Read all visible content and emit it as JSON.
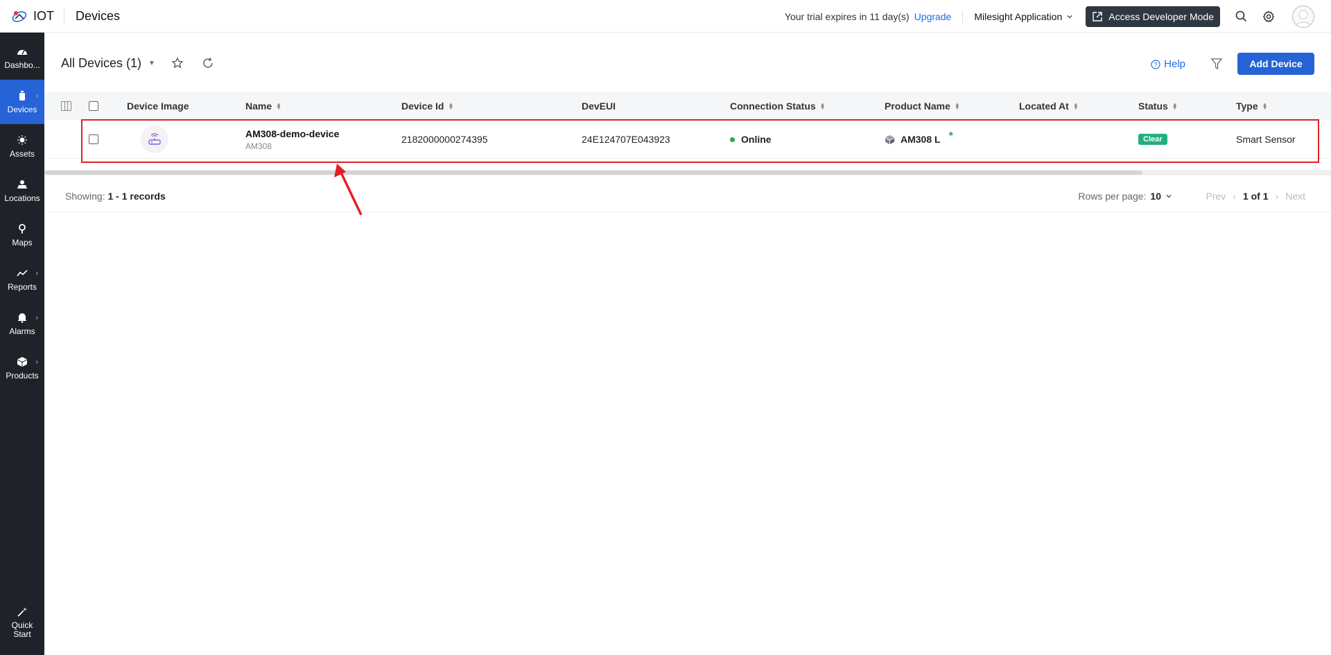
{
  "header": {
    "logo_text": "IOT",
    "page_title": "Devices",
    "trial_text": "Your trial expires in 11 day(s)",
    "upgrade_label": "Upgrade",
    "app_name": "Milesight Application",
    "dev_mode_label": "Access Developer Mode"
  },
  "sidebar": {
    "items": [
      {
        "label": "Dashbo..."
      },
      {
        "label": "Devices"
      },
      {
        "label": "Assets"
      },
      {
        "label": "Locations"
      },
      {
        "label": "Maps"
      },
      {
        "label": "Reports"
      },
      {
        "label": "Alarms"
      },
      {
        "label": "Products"
      }
    ],
    "quick_start": [
      "Quick",
      "Start"
    ]
  },
  "toolbar": {
    "view_title": "All Devices (1)",
    "help_label": "Help",
    "add_label": "Add Device"
  },
  "table": {
    "columns": [
      "Device Image",
      "Name",
      "Device Id",
      "DevEUI",
      "Connection Status",
      "Product Name",
      "Located At",
      "Status",
      "Type"
    ],
    "rows": [
      {
        "name": "AM308-demo-device",
        "model": "AM308",
        "device_id": "2182000000274395",
        "deveui": "24E124707E043923",
        "connection": "Online",
        "product": "AM308 L",
        "product_mark": "*",
        "located_at": "",
        "status": "Clear",
        "type": "Smart Sensor"
      }
    ]
  },
  "footer": {
    "showing_label": "Showing:",
    "showing_value": "1 - 1 records",
    "rpp_label": "Rows per page:",
    "rpp_value": "10",
    "prev_label": "Prev",
    "page_info": "1 of 1",
    "next_label": "Next"
  },
  "colors": {
    "accent": "#2563d6",
    "sidebar_bg": "#1f2329",
    "online": "#22a85a",
    "highlight": "#e21f26"
  }
}
